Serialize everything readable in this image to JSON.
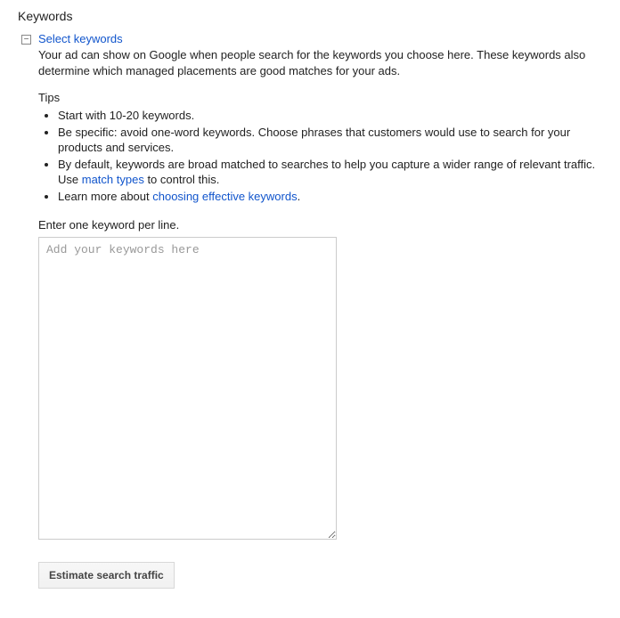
{
  "page": {
    "title": "Keywords"
  },
  "section": {
    "heading": "Select keywords",
    "description": "Your ad can show on Google when people search for the keywords you choose here. These keywords also determine which managed placements are good matches for your ads.",
    "tips_heading": "Tips",
    "tips": {
      "0": "Start with 10-20 keywords.",
      "1": "Be specific: avoid one-word keywords. Choose phrases that customers would use to search for your products and services.",
      "2_pre": "By default, keywords are broad matched to searches to help you capture a wider range of relevant traffic. Use ",
      "2_link": "match types",
      "2_post": " to control this.",
      "3_pre": "Learn more about ",
      "3_link": "choosing effective keywords",
      "3_post": "."
    },
    "input_label": "Enter one keyword per line.",
    "textarea_placeholder": "Add your keywords here",
    "textarea_value": "",
    "estimate_button": "Estimate search traffic"
  }
}
